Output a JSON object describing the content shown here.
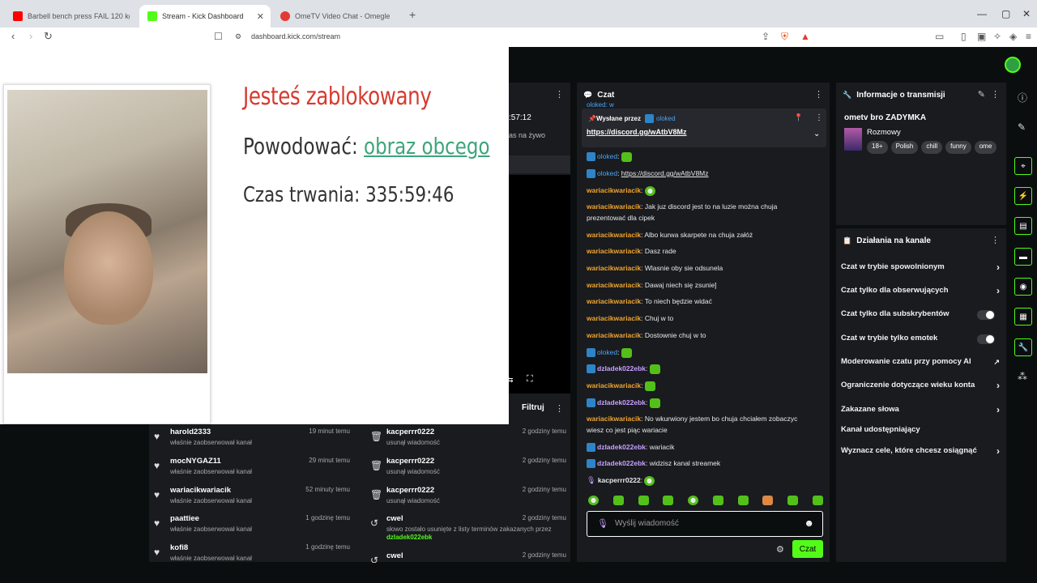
{
  "browser": {
    "tabs": [
      {
        "label": "Barbell bench press FAIL 120 kg x 12",
        "favicon_color": "#ff0000"
      },
      {
        "label": "Stream - Kick Dashboard",
        "favicon_color": "#53fc18"
      },
      {
        "label": "OmeTV Video Chat - Omegle R",
        "favicon_color": "#e53935"
      }
    ],
    "url": "dashboard.kick.com/stream"
  },
  "ban_overlay": {
    "title": "Jesteś zablokowany",
    "reason_label": "Powodować:",
    "reason_value": "obraz obcego",
    "duration": "Czas trwania: 335:59:46"
  },
  "partial_panel": {
    "timer": ":57:12",
    "text": "as na żywo",
    "filter_label": "Filtruj"
  },
  "followers_feed": [
    {
      "name": "harold2333",
      "sub": "właśnie zaobserwował kanał",
      "time": "19 minut temu"
    },
    {
      "name": "mocNYGAZ11",
      "sub": "właśnie zaobserwował kanał",
      "time": "29 minut temu"
    },
    {
      "name": "wariacikwariacik",
      "sub": "właśnie zaobserwował kanał",
      "time": "52 minuty temu"
    },
    {
      "name": "paattiee",
      "sub": "właśnie zaobserwował kanał",
      "time": "1 godzinę temu"
    },
    {
      "name": "kofi8",
      "sub": "właśnie zaobserwował kanał",
      "time": "1 godzinę temu"
    }
  ],
  "mod_feed": [
    {
      "name": "kacperrr0222",
      "sub": "usunął wiadomość",
      "time": "2 godziny temu",
      "icon": "trash-icon"
    },
    {
      "name": "kacperrr0222",
      "sub": "usunął wiadomość",
      "time": "2 godziny temu",
      "icon": "trash-icon"
    },
    {
      "name": "kacperrr0222",
      "sub": "usunął wiadomość",
      "time": "2 godziny temu",
      "icon": "trash-icon"
    },
    {
      "name": "cwel",
      "sub": "słowo zostało usunięte z listy terminów zakazanych przez",
      "sub_user": "dzIadek022ebk",
      "time": "2 godziny temu",
      "icon": "undo-icon"
    },
    {
      "name": "cwel",
      "sub": "",
      "time": "2 godziny temu",
      "icon": "undo-icon"
    }
  ],
  "chat": {
    "title": "Czat",
    "pinned_by_label": "Wysłane przez",
    "pinned_by_user": "oloked",
    "pinned_link": "https://discord.gg/wAtbV8Mz",
    "cut_top": "oloked: w",
    "messages": [
      {
        "user": "oloked",
        "text": "",
        "style": "blue",
        "emote": "square"
      },
      {
        "user": "oloked",
        "text": "https://discord.gg/wAtbV8Mz",
        "style": "blue"
      },
      {
        "user": "wariacikwariacik",
        "text": "",
        "style": "orange",
        "emote": "round"
      },
      {
        "user": "wariacikwariacik",
        "text": "Jak juz discord jest to na luzie można chuja prezentować dla cipek",
        "style": "orange"
      },
      {
        "user": "wariacikwariacik",
        "text": "Albo kurwa skarpete na chuja załóż",
        "style": "orange"
      },
      {
        "user": "wariacikwariacik",
        "text": "Dasz rade",
        "style": "orange"
      },
      {
        "user": "wariacikwariacik",
        "text": "Wlasnie oby sie odsunela",
        "style": "orange"
      },
      {
        "user": "wariacikwariacik",
        "text": "Dawaj niech się zsunie]",
        "style": "orange"
      },
      {
        "user": "wariacikwariacik",
        "text": "To niech będzie widać",
        "style": "orange"
      },
      {
        "user": "wariacikwariacik",
        "text": "Chuj w to",
        "style": "orange"
      },
      {
        "user": "wariacikwariacik",
        "text": "Dostownie chuj w to",
        "style": "orange"
      },
      {
        "user": "oloked",
        "text": "",
        "style": "blue",
        "emote": "square"
      },
      {
        "user": "dzIadek022ebk",
        "text": "",
        "style": "purple",
        "emote": "square"
      },
      {
        "user": "wariacikwariacik",
        "text": "",
        "style": "orange",
        "emote": "square"
      },
      {
        "user": "dzIadek022ebk",
        "text": "",
        "style": "purple",
        "emote": "square"
      },
      {
        "user": "wariacikwariacik",
        "text": "No wkurwiony jestem bo chuja chciałem zobaczyc wiesz co jest piąc wariacie",
        "style": "orange"
      },
      {
        "user": "dzIadek022ebk",
        "text": "wariacik",
        "style": "purple"
      },
      {
        "user": "dzIadek022ebk",
        "text": "widzisz kanal streamek",
        "style": "purple"
      },
      {
        "user": "kacperrr0222",
        "text": "",
        "style": "white",
        "emote": "round"
      }
    ],
    "input_placeholder": "Wyślij wiadomość",
    "send_label": "Czat"
  },
  "stream_info": {
    "title": "Informacje o transmisji",
    "stream_title": "ometv bro ZADYMKA",
    "category": "Rozmowy",
    "tags": [
      "18+",
      "Polish",
      "chill",
      "funny",
      "ome"
    ]
  },
  "channel_actions": {
    "title": "Działania na kanale",
    "items": [
      {
        "label": "Czat w trybie spowolnionym",
        "control": "chevron"
      },
      {
        "label": "Czat tylko dla obserwujących",
        "control": "chevron"
      },
      {
        "label": "Czat tylko dla subskrybentów",
        "control": "toggle",
        "on": false
      },
      {
        "label": "Czat w trybie tylko emotek",
        "control": "toggle",
        "on": false
      },
      {
        "label": "Moderowanie czatu przy pomocy AI",
        "control": "external"
      },
      {
        "label": "Ograniczenie dotyczące wieku konta",
        "control": "chevron"
      },
      {
        "label": "Zakazane słowa",
        "control": "chevron"
      },
      {
        "label": "Kanał udostępniający",
        "control": "none"
      },
      {
        "label": "Wyznacz cele, które chcesz osiągnąć",
        "control": "chevron"
      }
    ]
  },
  "colors": {
    "accent": "#53fc18",
    "panel": "#191b1f",
    "bg": "#0b0e0f",
    "ban_red": "#d63b2f",
    "link_green": "#3ea57a"
  }
}
